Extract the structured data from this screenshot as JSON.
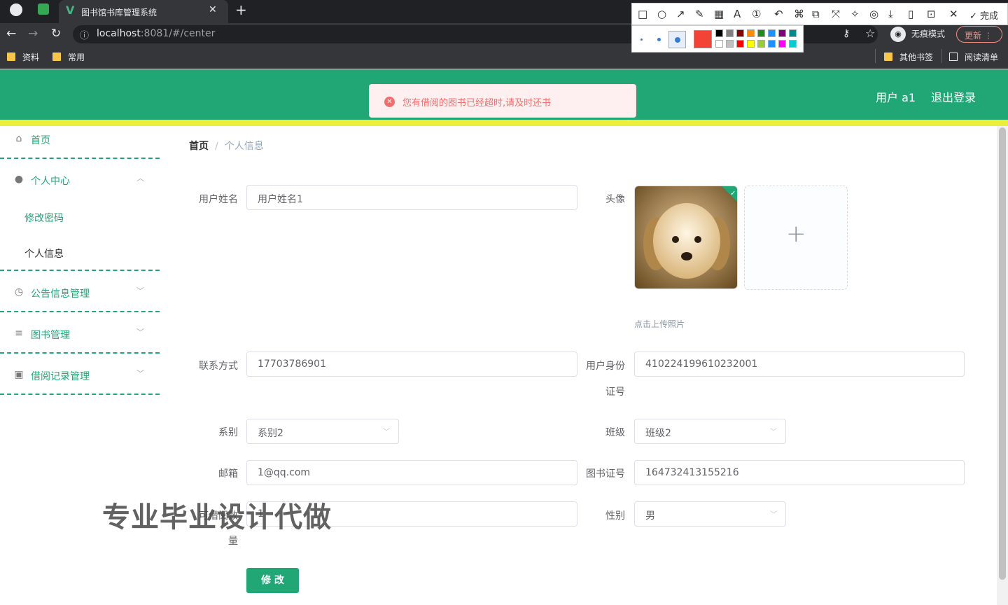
{
  "browser": {
    "tab_title": "图书馆书库管理系统",
    "url_host": "localhost",
    "url_rest": ":8081/#/center",
    "bookmarks": [
      "资料",
      "常用"
    ],
    "other_bookmarks": "其他书签",
    "reading_list": "阅读清单",
    "incognito_label": "无痕模式",
    "update_label": "更新"
  },
  "snap_toolbar": {
    "done_label": "完成",
    "current_color": "#f44336",
    "palette": [
      "#000000",
      "#808080",
      "#8b0000",
      "#ff8c00",
      "#228b22",
      "#1e90ff",
      "#800080",
      "#008b8b",
      "#ffffff",
      "#c0c0c0",
      "#ff0000",
      "#ffff00",
      "#9acd32",
      "#1e90ff",
      "#ff00ff",
      "#00ced1"
    ]
  },
  "header": {
    "user_label": "用户 a1",
    "logout_label": "退出登录",
    "brand_color": "#21a676"
  },
  "alert": {
    "message": "您有借阅的图书已经超时,请及时还书"
  },
  "sidebar": {
    "home": "首页",
    "personal_center": "个人中心",
    "change_password": "修改密码",
    "personal_info": "个人信息",
    "notice_mgmt": "公告信息管理",
    "book_mgmt": "图书管理",
    "borrow_mgmt": "借阅记录管理"
  },
  "breadcrumb": {
    "home": "首页",
    "separator": "/",
    "current": "个人信息"
  },
  "form": {
    "username_label": "用户姓名",
    "username_value": "用户姓名1",
    "avatar_label": "头像",
    "upload_tip": "点击上传照片",
    "phone_label": "联系方式",
    "phone_value": "17703786901",
    "idcard_label_1": "用户身份",
    "idcard_label_2": "证号",
    "idcard_value": "410224199610232001",
    "dept_label": "系别",
    "dept_value": "系别2",
    "class_label": "班级",
    "class_value": "班级2",
    "email_label": "邮箱",
    "email_value": "1@qq.com",
    "libcard_label": "图书证号",
    "libcard_value": "164732413155216",
    "borrowable_label_1": "可借阅数",
    "borrowable_label_2": "量",
    "borrowable_value": "1",
    "gender_label": "性别",
    "gender_value": "男",
    "submit_label": "修 改"
  },
  "watermark": "专业毕业设计代做"
}
